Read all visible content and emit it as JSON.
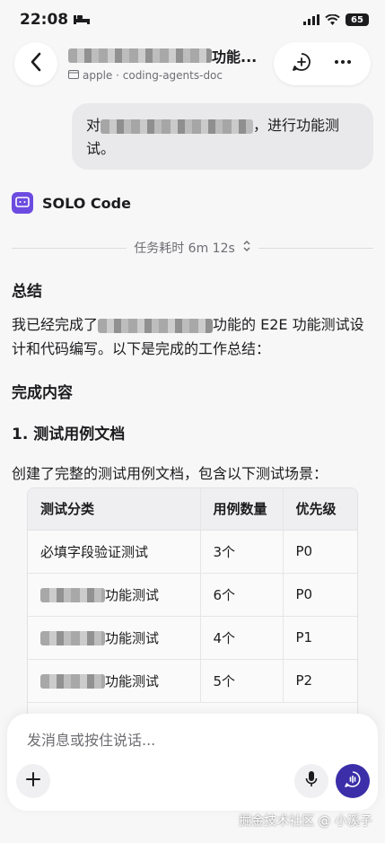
{
  "status_bar": {
    "time": "22:08",
    "battery": "65"
  },
  "header": {
    "title_suffix": "功能...",
    "subtitle": "apple · coding-agents-doc"
  },
  "user_message": {
    "prefix": "对",
    "suffix": "，进行功能测试。"
  },
  "agent": {
    "name": "SOLO Code",
    "task_time": "任务耗时 6m 12s"
  },
  "content": {
    "summary_heading": "总结",
    "summary_prefix": "我已经完成了",
    "summary_suffix": "功能的 E2E 功能测试设计和代码编写。以下是完成的工作总结：",
    "done_heading": "完成内容",
    "doc_heading": "1. 测试用例文档",
    "doc_para": "创建了完整的测试用例文档，包含以下测试场景："
  },
  "table": {
    "headers": [
      "测试分类",
      "用例数量",
      "优先级"
    ],
    "rows": [
      {
        "category": "必填字段验证测试",
        "count": "3个",
        "priority": "P0"
      },
      {
        "category": "功能测试",
        "count": "6个",
        "priority": "P0"
      },
      {
        "category": "功能测试",
        "count": "4个",
        "priority": "P1"
      },
      {
        "category": "功能测试",
        "count": "5个",
        "priority": "P2"
      }
    ]
  },
  "composer": {
    "placeholder": "发消息或按住说话..."
  },
  "watermark": "掘金技术社区 @ 小溪子",
  "colors": {
    "agent_accent": "#6c4be0",
    "voice_button": "#3b2ea8"
  },
  "icons": [
    "signal-icon",
    "wifi-icon",
    "back-chevron-icon",
    "new-chat-icon",
    "more-icon",
    "agent-icon",
    "chevron-updown-icon",
    "plus-icon",
    "mic-icon",
    "voice-chat-icon"
  ]
}
